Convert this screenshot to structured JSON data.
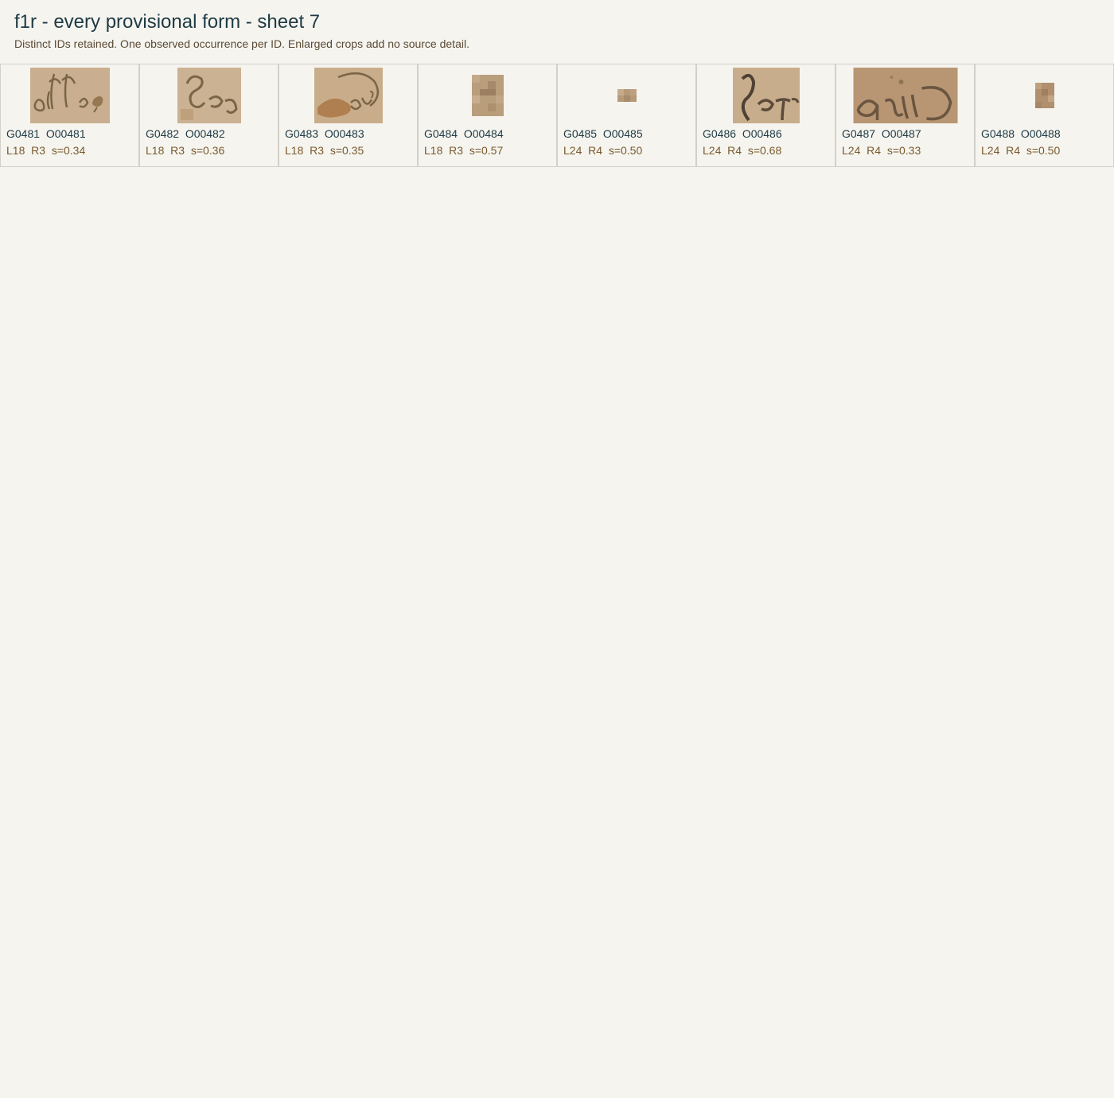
{
  "title": "f1r - every provisional form - sheet 7",
  "subtitle": "Distinct IDs retained. One observed occurrence per ID. Enlarged crops add no source detail.",
  "cells": [
    {
      "ids": "G0481  O00481",
      "meta": "L18  R3  s=0.34"
    },
    {
      "ids": "G0482  O00482",
      "meta": "L18  R3  s=0.36"
    },
    {
      "ids": "G0483  O00483",
      "meta": "L18  R3  s=0.35"
    },
    {
      "ids": "G0484  O00484",
      "meta": "L18  R3  s=0.57"
    },
    {
      "ids": "G0485  O00485",
      "meta": "L24  R4  s=0.50"
    },
    {
      "ids": "G0486  O00486",
      "meta": "L24  R4  s=0.68"
    },
    {
      "ids": "G0487  O00487",
      "meta": "L24  R4  s=0.33"
    },
    {
      "ids": "G0488  O00488",
      "meta": "L24  R4  s=0.50"
    }
  ],
  "colors": {
    "background": "#f5f4ef",
    "title": "#1e3a44",
    "meta": "#7a5a2c",
    "parchment": "#c8ac8a",
    "ink": "#6e5a40"
  }
}
